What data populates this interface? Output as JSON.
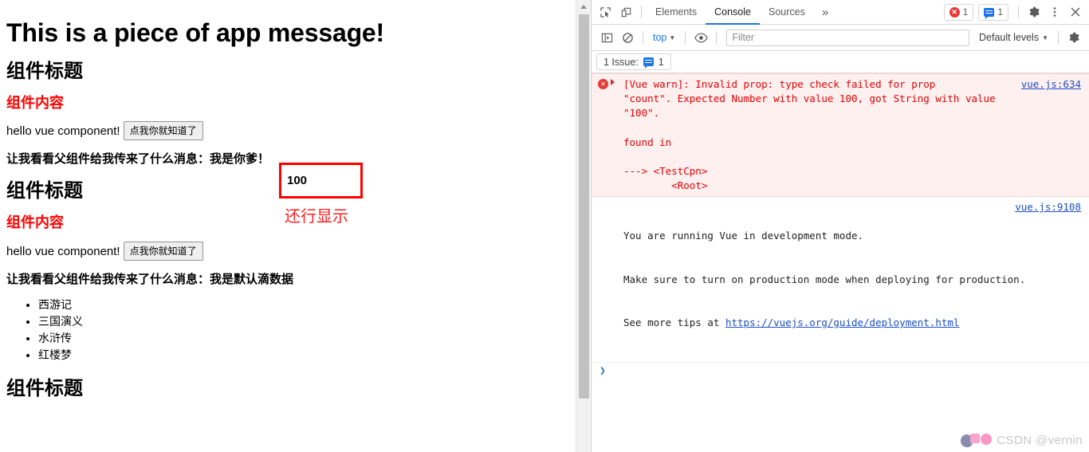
{
  "page": {
    "app_title": "This is a piece of app message!",
    "components": [
      {
        "heading": "组件标题",
        "content_heading": "组件内容",
        "hello_text": "hello vue component!",
        "button_label": "点我你就知道了",
        "message_line": "让我看看父组件给我传来了什么消息：我是你爹！",
        "count_value": "100",
        "books": []
      },
      {
        "heading": "组件标题",
        "content_heading": "组件内容",
        "hello_text": "hello vue component!",
        "button_label": "点我你就知道了",
        "message_line": "让我看看父组件给我传来了什么消息：我是默认滴数据",
        "count_value": "",
        "books": [
          "西游记",
          "三国演义",
          "水浒传",
          "红楼梦"
        ]
      },
      {
        "heading": "组件标题",
        "content_heading": "",
        "hello_text": "",
        "button_label": "",
        "message_line": "",
        "count_value": "",
        "books": []
      }
    ],
    "annotation_label": "还行显示",
    "annotation_color": "#ff2020"
  },
  "devtools": {
    "tabs": [
      {
        "label": "Elements",
        "active": false
      },
      {
        "label": "Console",
        "active": true
      },
      {
        "label": "Sources",
        "active": false
      }
    ],
    "more_tabs_glyph": "»",
    "error_badge_count": "1",
    "issue_badge_count": "1",
    "settings_icon": "gear-icon",
    "kebab_icon": "more-vertical-icon",
    "close_icon": "close-icon",
    "inspect_icon": "inspect-element-icon",
    "device_icon": "device-toolbar-icon",
    "filterbar": {
      "sidebar_toggle_icon": "console-sidebar-icon",
      "clear_icon": "clear-console-icon",
      "context": "top",
      "eye_icon": "live-expression-icon",
      "filter_placeholder": "Filter",
      "filter_value": "",
      "levels_label": "Default levels",
      "settings_icon": "console-settings-gear-icon"
    },
    "issue_bar": {
      "label": "1 Issue:",
      "count": "1"
    },
    "messages": [
      {
        "type": "error",
        "text": "[Vue warn]: Invalid prop: type check failed for prop\n\"count\". Expected Number with value 100, got String with value\n\"100\".\n\nfound in\n\n---> <TestCpn>\n        <Root>",
        "source": "vue.js:634"
      },
      {
        "type": "info",
        "text_line1": "You are running Vue in development mode.",
        "text_line2": "Make sure to turn on production mode when deploying for production.",
        "text_line3_prefix": "See more tips at ",
        "text_line3_link": "https://vuejs.org/guide/deployment.html",
        "source": "vue.js:9108"
      }
    ],
    "prompt_glyph": "❯"
  },
  "watermark": {
    "text": "CSDN @vernin"
  }
}
